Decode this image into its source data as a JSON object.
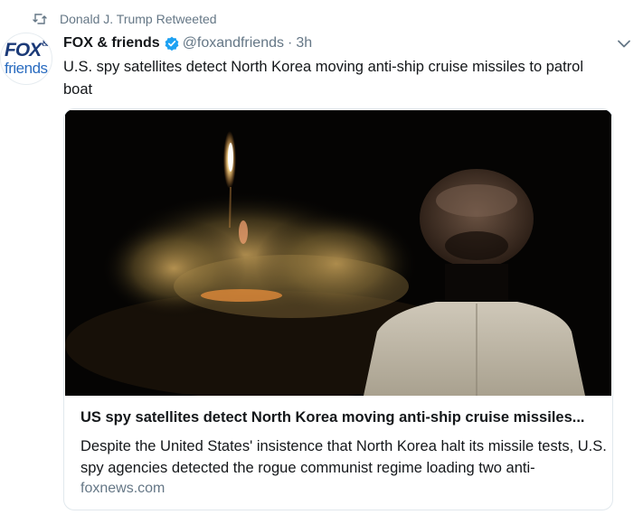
{
  "retweet": {
    "icon": "retweet-icon",
    "text": "Donald J. Trump Retweeted"
  },
  "author": {
    "avatar_icon": "fox-and-friends-logo",
    "avatar_logo_text": [
      "FOX",
      "&",
      "friends"
    ],
    "display_name": "FOX & friends",
    "verified_icon": "verified-badge-icon",
    "handle": "@foxandfriends",
    "separator": "·",
    "time": "3h"
  },
  "menu_icon": "chevron-down-icon",
  "tweet": {
    "text": "U.S. spy satellites detect North Korea moving anti-ship cruise missiles to patrol boat"
  },
  "card": {
    "title": "US spy satellites detect North Korea moving anti-ship cruise missiles...",
    "description": "Despite the United States' insistence that North Korea halt its missile tests, U.S. spy agencies detected the rogue communist regime loading two anti-",
    "domain": "foxnews.com"
  },
  "colors": {
    "text": "#14171a",
    "secondary": "#657786",
    "verified": "#1da1f2",
    "border": "#e1e8ed"
  }
}
